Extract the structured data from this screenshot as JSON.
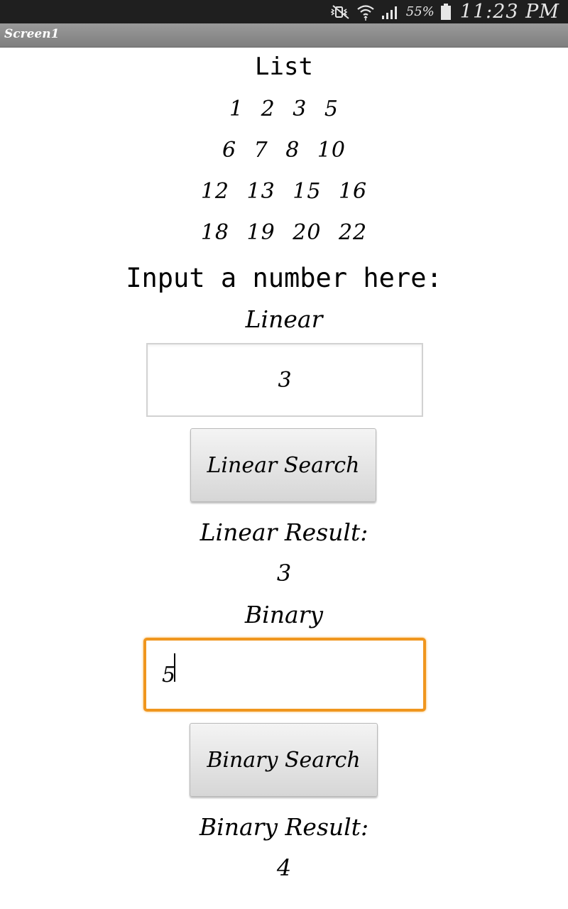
{
  "status_bar": {
    "battery_pct": "55%",
    "clock": "11:23 PM"
  },
  "title_bar": {
    "title": "Screen1"
  },
  "list": {
    "title": "List",
    "rows": [
      "1  2  3  5",
      "6  7  8  10",
      "12 13 15 16",
      "18 19 20 22"
    ]
  },
  "prompt": "Input a number here:",
  "linear": {
    "label": "Linear",
    "input_value": "3",
    "button_label": "Linear Search",
    "result_label": "Linear Result:",
    "result_value": "3"
  },
  "binary": {
    "label": "Binary",
    "input_value": "5",
    "button_label": "Binary Search",
    "result_label": "Binary Result:",
    "result_value": "4"
  },
  "colors": {
    "focus_border": "#f0961e",
    "status_bar_bg": "#1f1f1f",
    "title_bar_bg": "#8c8c8c"
  },
  "icons": [
    "mute-vibrate-icon",
    "wifi-icon",
    "signal-icon",
    "battery-icon"
  ]
}
